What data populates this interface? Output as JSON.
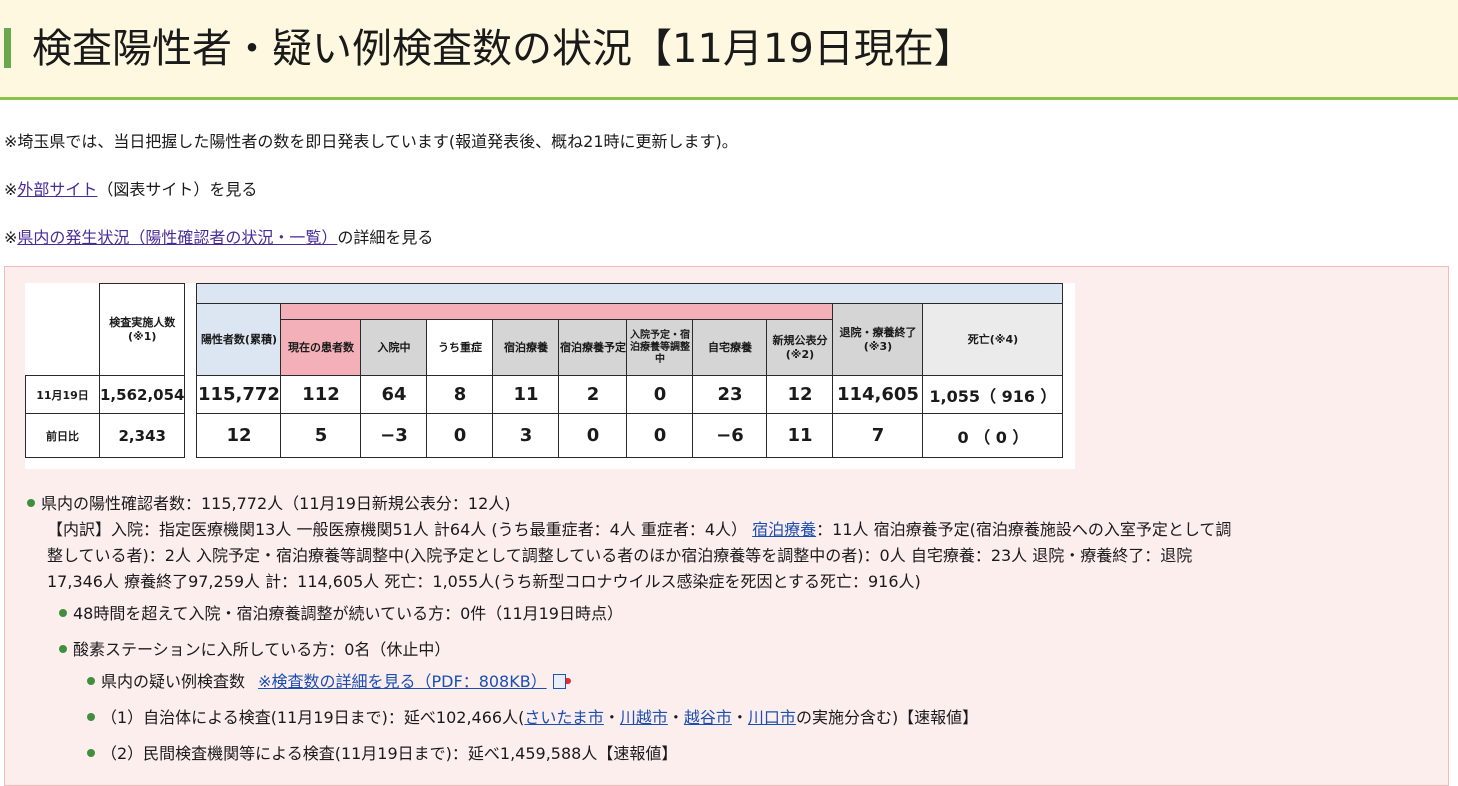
{
  "title": "検査陽性者・疑い例検査数の状況【11月19日現在】",
  "notes": {
    "n1": "※埼玉県では、当日把握した陽性者の数を即日発表しています(報道発表後、概ね21時に更新します)。",
    "n2_prefix": "※",
    "n2_link": "外部サイト",
    "n2_suffix": "（図表サイト）を見る",
    "n3_prefix": "※",
    "n3_link": "県内の発生状況（陽性確認者の状況・一覧）",
    "n3_suffix": "の詳細を見る"
  },
  "table": {
    "headers": {
      "tested": "検査実施人数(※1)",
      "positive": "陽性者数(累積)",
      "current": "現在の患者数",
      "hospital": "入院中",
      "severe": "うち重症",
      "hotel": "宿泊療養",
      "hotel_plan": "宿泊療養予定",
      "adjusting": "入院予定・宿泊療養等調整中",
      "home": "自宅療養",
      "new": "新規公表分(※2)",
      "recovered": "退院・療養終了(※3)",
      "deaths": "死亡(※4)"
    },
    "rows": [
      {
        "label": "11月19日",
        "tested": "1,562,054",
        "positive": "115,772",
        "current": "112",
        "hospital": "64",
        "severe": "8",
        "hotel": "11",
        "hotel_plan": "2",
        "adjusting": "0",
        "home": "23",
        "new": "12",
        "recovered": "114,605",
        "deaths": "1,055（ 916 ）"
      },
      {
        "label": "前日比",
        "tested": "2,343",
        "positive": "12",
        "current": "5",
        "hospital": "−3",
        "severe": "0",
        "hotel": "3",
        "hotel_plan": "0",
        "adjusting": "0",
        "home": "−6",
        "new": "11",
        "recovered": "7",
        "deaths": "0 （ 0 ）"
      }
    ]
  },
  "summary": {
    "line1": "県内の陽性確認者数：115,772人（11月19日新規公表分：12人)",
    "line2_pre": "【内訳】入院：指定医療機関13人 一般医療機関51人 計64人 (うち最重症者：4人 重症者：4人）",
    "line2_link": "宿泊療養",
    "line2_post": "：11人 宿泊療養予定(宿泊療養施設への入室予定として調",
    "line3": "整している者)：2人 入院予定・宿泊療養等調整中(入院予定として調整している者のほか宿泊療養等を調整中の者)：0人 自宅療養：23人 退院・療養終了：退院",
    "line4": "17,346人 療養終了97,259人 計：114,605人 死亡：1,055人(うち新型コロナウイルス感染症を死因とする死亡：916人)"
  },
  "bullets": {
    "b1": "48時間を超えて入院・宿泊療養調整が続いている方：0件（11月19日時点）",
    "b2": "酸素ステーションに入所している方：0名（休止中）",
    "b3_pre": "県内の疑い例検査数",
    "b3_link": "※検査数の詳細を見る（PDF：808KB）",
    "b4_pre": "（1）自治体による検査(11月19日まで)：延べ102,466人(",
    "b4_link1": "さいたま市",
    "b4_sep1": "・",
    "b4_link2": "川越市",
    "b4_sep2": "・",
    "b4_link3": "越谷市",
    "b4_sep3": "・",
    "b4_link4": "川口市",
    "b4_post": "の実施分含む)【速報値】",
    "b5": "（2）民間検査機関等による検査(11月19日まで)：延べ1,459,588人【速報値】"
  },
  "colors": {
    "title_bg": "#fdf8df",
    "title_rule": "#8bc34a",
    "panel_bg": "#fdeeee",
    "header_pink": "#f4b0b8",
    "header_blue": "#dce6f2",
    "header_grey": "#d5d5d5",
    "link": "#4a2b9a"
  }
}
